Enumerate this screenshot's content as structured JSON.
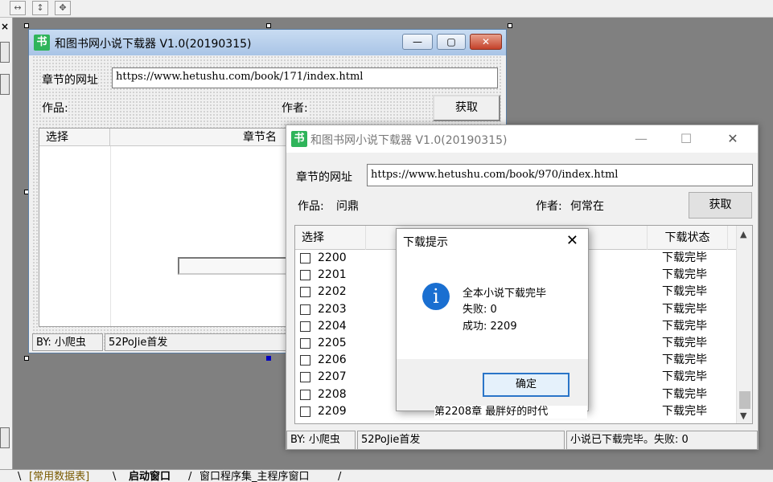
{
  "ide": {
    "toolbar_icons": [
      "resize-width-icon",
      "resize-height-icon",
      "resize-both-icon"
    ],
    "left_close": "×",
    "bottom_tabs": [
      {
        "label": "[常用数据表]"
      },
      {
        "label": "启动窗口"
      },
      {
        "label": "窗口程序集_主程序窗口"
      }
    ]
  },
  "design_window": {
    "icon": "书",
    "title": "和图书网小说下载器 V1.0(20190315)",
    "url_label": "章节的网址",
    "url_value": "https://www.hetushu.com/book/171/index.html",
    "work_label": "作品:",
    "author_label": "作者:",
    "fetch_button": "获取",
    "columns": [
      "选择",
      "章节名"
    ],
    "status": [
      "BY: 小爬虫",
      "52PoJie首发"
    ]
  },
  "app_window": {
    "icon": "书",
    "title": "和图书网小说下载器 V1.0(20190315)",
    "url_label": "章节的网址",
    "url_value": "https://www.hetushu.com/book/970/index.html",
    "work_label": "作品:",
    "work_value": "问鼎",
    "author_label": "作者:",
    "author_value": "何常在",
    "fetch_button": "获取",
    "columns": [
      "选择",
      "下载状态"
    ],
    "rows": [
      {
        "num": "2200",
        "state": "下载完毕"
      },
      {
        "num": "2201",
        "state": "下载完毕"
      },
      {
        "num": "2202",
        "state": "下载完毕"
      },
      {
        "num": "2203",
        "state": "下载完毕"
      },
      {
        "num": "2204",
        "state": "下载完毕"
      },
      {
        "num": "2205",
        "state": "下载完毕"
      },
      {
        "num": "2206",
        "state": "下载完毕"
      },
      {
        "num": "2207",
        "state": "下载完毕"
      },
      {
        "num": "2208",
        "state": "下载完毕"
      },
      {
        "num": "2209",
        "state": "下载完毕"
      }
    ],
    "partial_chapter": "第2208章 最胖好的时代",
    "status_by": "BY: 小爬虫",
    "status_src": "52PoJie首发",
    "status_result": "小说已下载完毕。失败: 0"
  },
  "dialog": {
    "title": "下载提示",
    "line1": "全本小说下载完毕",
    "line2": "失败: 0",
    "line3": "成功: 2209",
    "ok": "确定",
    "icon": "info-icon"
  },
  "colors": {
    "accent": "#2a75c8",
    "info": "#1a6fd1",
    "icon_green": "#2fb45a"
  }
}
